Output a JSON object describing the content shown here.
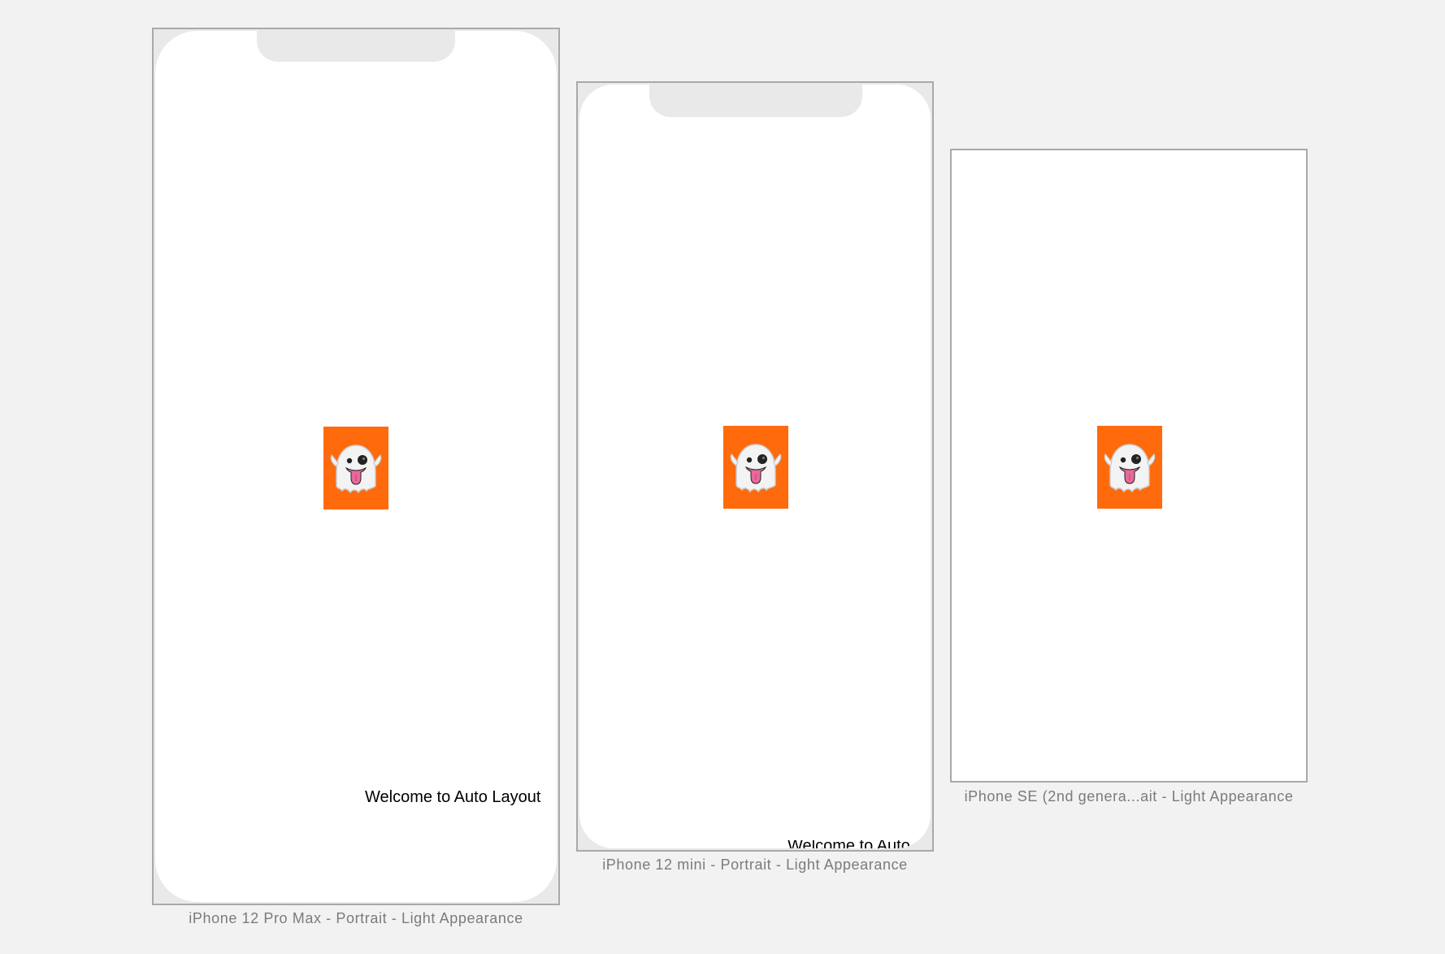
{
  "canvas": {
    "background": "#f2f2f2"
  },
  "devices": [
    {
      "id": "iphone-12-pro-max",
      "caption": "iPhone 12 Pro Max - Portrait - Light Appearance",
      "has_notch": true,
      "welcome_text": "Welcome to Auto Layout",
      "image": {
        "icon": "ghost-emoji-icon",
        "background": "#ff6a0c"
      }
    },
    {
      "id": "iphone-12-mini",
      "caption": "iPhone 12 mini - Portrait - Light Appearance",
      "has_notch": true,
      "welcome_text": "Welcome to Auto",
      "image": {
        "icon": "ghost-emoji-icon",
        "background": "#ff6a0c"
      }
    },
    {
      "id": "iphone-se-2nd-gen",
      "caption": "iPhone SE (2nd genera...ait - Light Appearance",
      "has_notch": false,
      "image": {
        "icon": "ghost-emoji-icon",
        "background": "#ff6a0c"
      }
    }
  ]
}
